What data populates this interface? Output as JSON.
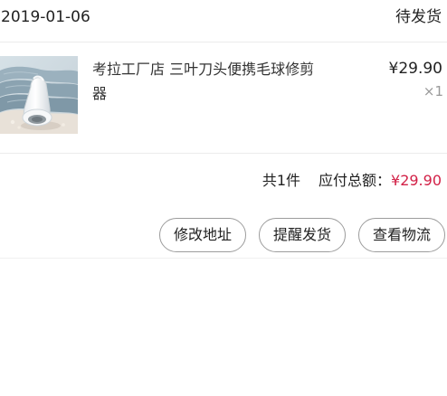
{
  "order": {
    "date": "2019-01-06",
    "status": "待发货",
    "product": {
      "image_icon": "lint-remover-product-image",
      "title": "考拉工厂店 三叶刀头便携毛球修剪器",
      "price": "¥29.90",
      "quantity": "×1"
    },
    "summary": {
      "count": "共1件",
      "total_label": "应付总额：",
      "total_value": "¥29.90"
    },
    "actions": [
      {
        "label": "修改地址"
      },
      {
        "label": "提醒发货"
      },
      {
        "label": "查看物流"
      }
    ]
  },
  "colors": {
    "accent": "#d22147",
    "border": "#ececec",
    "text": "#222222",
    "muted": "#999999"
  }
}
